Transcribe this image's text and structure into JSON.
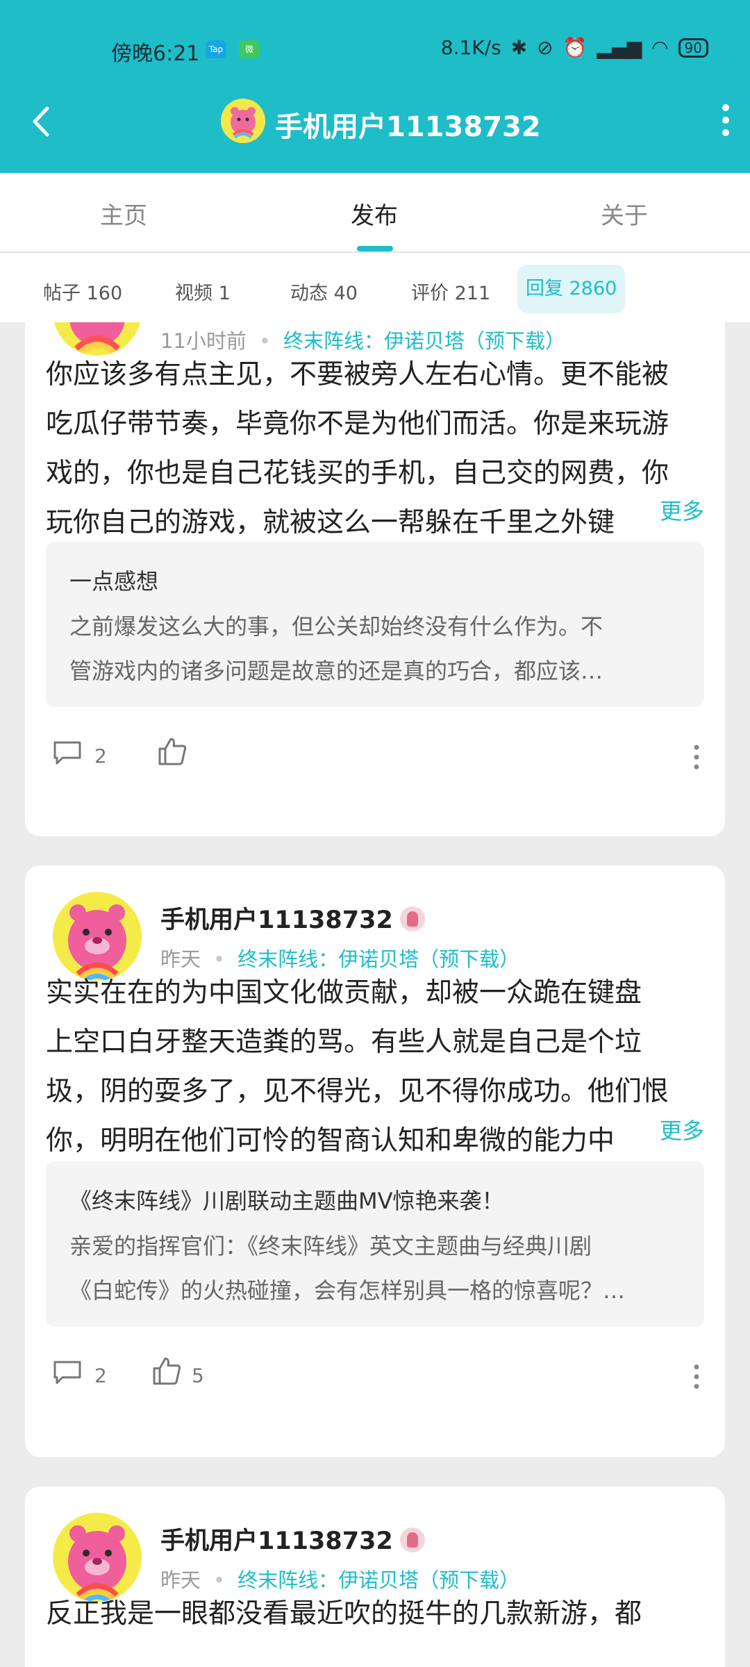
{
  "status_bar": {
    "time": "傍晚6:21",
    "app_icons": [
      "Tap",
      "微"
    ],
    "net_speed": "8.1K/s",
    "battery": "90"
  },
  "header": {
    "title": "手机用户11138732"
  },
  "tabs": [
    {
      "label": "主页",
      "active": false
    },
    {
      "label": "发布",
      "active": true
    },
    {
      "label": "关于",
      "active": false
    }
  ],
  "subtabs": [
    {
      "label": "帖子 160",
      "active": false
    },
    {
      "label": "视频 1",
      "active": false
    },
    {
      "label": "动态 40",
      "active": false
    },
    {
      "label": "评价 211",
      "active": false
    },
    {
      "label": "回复 2860",
      "active": true
    }
  ],
  "posts": [
    {
      "time": "11小时前",
      "game": "终末阵线：伊诺贝塔（预下载）",
      "lines": [
        "你应该多有点主见，不要被旁人左右心情。更不能被",
        "吃瓜仔带节奏，毕竟你不是为他们而活。你是来玩游",
        "戏的，你也是自己花钱买的手机，自己交的网费，你",
        "玩你自己的游戏，就被这么一帮躲在千里之外键"
      ],
      "more": "更多",
      "quote_title": "一点感想",
      "quote_lines": [
        "之前爆发这么大的事，但公关却始终没有什么作为。不",
        "管游戏内的诸多问题是故意的还是真的巧合，都应该…"
      ],
      "comments": "2",
      "likes": ""
    },
    {
      "username": "手机用户11138732",
      "time": "昨天",
      "game": "终末阵线：伊诺贝塔（预下载）",
      "lines": [
        "实实在在的为中国文化做贡献，却被一众跪在键盘",
        "上空口白牙整天造粪的骂。有些人就是自己是个垃",
        "圾，阴的耍多了，见不得光，见不得你成功。他们恨",
        "你，明明在他们可怜的智商认知和卑微的能力中"
      ],
      "more": "更多",
      "quote_title": "《终末阵线》川剧联动主题曲MV惊艳来袭！",
      "quote_lines": [
        "亲爱的指挥官们：《终末阵线》英文主题曲与经典川剧",
        "《白蛇传》的火热碰撞，会有怎样别具一格的惊喜呢？…"
      ],
      "comments": "2",
      "likes": "5"
    },
    {
      "username": "手机用户11138732",
      "time": "昨天",
      "game": "终末阵线：伊诺贝塔（预下载）",
      "lines": [
        "反正我是一眼都没看最近吹的挺牛的几款新游，都"
      ]
    }
  ],
  "colors": {
    "accent": "#1ebdc8",
    "header_bg": "#1ebdc8",
    "page_bg": "#ececec"
  }
}
